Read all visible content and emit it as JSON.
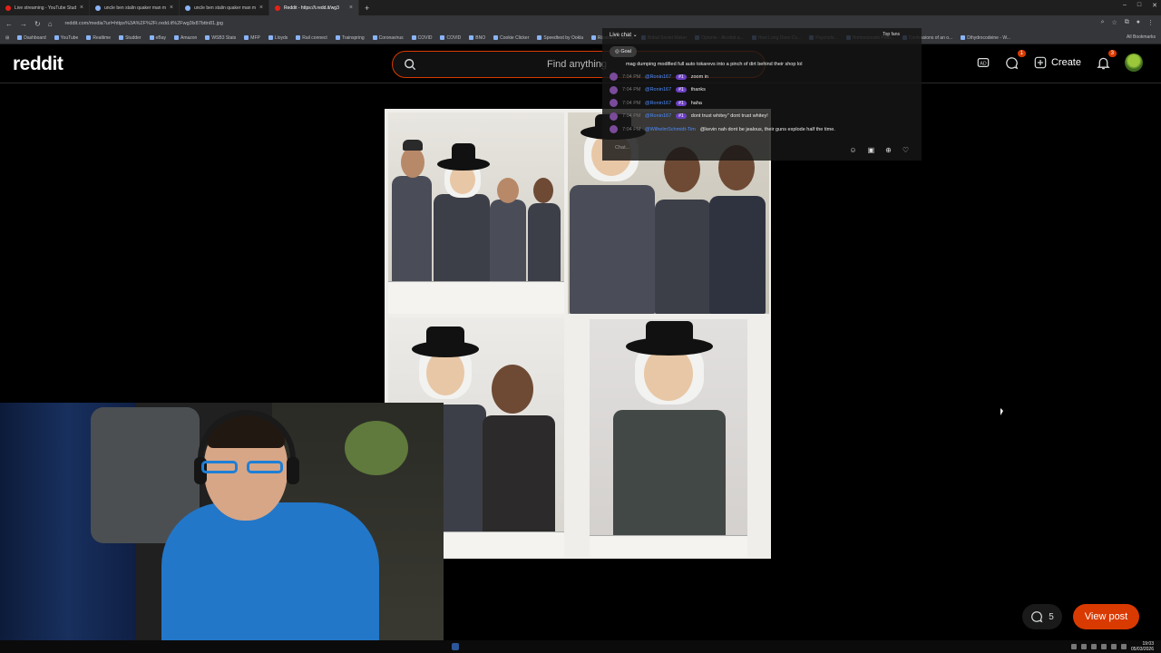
{
  "browser": {
    "tabs": [
      {
        "title": "Live streaming - YouTube Stud",
        "active": false
      },
      {
        "title": "uncle ben stalin quaker man m",
        "active": false
      },
      {
        "title": "uncle ben stalin quaker man m",
        "active": false
      },
      {
        "title": "Reddit - https://i.redd.it/wg3",
        "active": true
      }
    ],
    "new_tab": "+",
    "url": "reddit.com/media?url=https%3A%2F%2Fi.redd.it%2Fwg3lx87bttn81.jpg",
    "bookmarks": [
      "Dashboard",
      "YouTube",
      "Realtime",
      "Studder",
      "eBay",
      "Amazon",
      "WSB3 Stats",
      "MFP",
      "Lloyds",
      "Rail connect",
      "Trainspring",
      "Coronavirus",
      "COVID",
      "COVID",
      "BNO",
      "Cookie Clicker",
      "Speedtest by Ookla",
      "Ripaliana Vlandia",
      "Bobal Soviet Maker",
      "Optonie - Alcohol a...",
      "How Long Does Co...",
      "Psycholo...",
      "Homosunoski Prim...",
      "Confessions of an o...",
      "Dihydrocodeine - W..."
    ],
    "all_bookmarks": "All Bookmarks"
  },
  "reddit": {
    "logo": "reddit",
    "search_placeholder": "Find anything",
    "create_label": "Create",
    "chat_badge": "1",
    "notif_badge": "3",
    "comment_count": "5",
    "view_post_label": "View post",
    "accent": "#d93a00"
  },
  "livechat": {
    "title": "Live chat",
    "top_fans": "Top fans",
    "goal": "Goal",
    "pinned": "mag dumping modified full auto tokarevs into a pinch of dirt behind their shop lol",
    "messages": [
      {
        "time": "7:04 PM",
        "user": "@Ronin167",
        "badge": "#1",
        "text": "zoom in"
      },
      {
        "time": "7:04 PM",
        "user": "@Ronin167",
        "badge": "#1",
        "text": "thanks"
      },
      {
        "time": "7:04 PM",
        "user": "@Ronin167",
        "badge": "#1",
        "text": "haha"
      },
      {
        "time": "7:04 PM",
        "user": "@Ronin167",
        "badge": "#1",
        "text": "dont trust whitey\" dont trust whitey!"
      },
      {
        "time": "7:04 PM",
        "user": "@WilhelmSchmidt-Tim",
        "badge": "",
        "text": "@kevin nah dont be jealous, their guns explode half the time."
      }
    ],
    "input_placeholder": "Chat..."
  },
  "taskbar": {
    "time": "19:03",
    "date": "05/03/2026"
  }
}
